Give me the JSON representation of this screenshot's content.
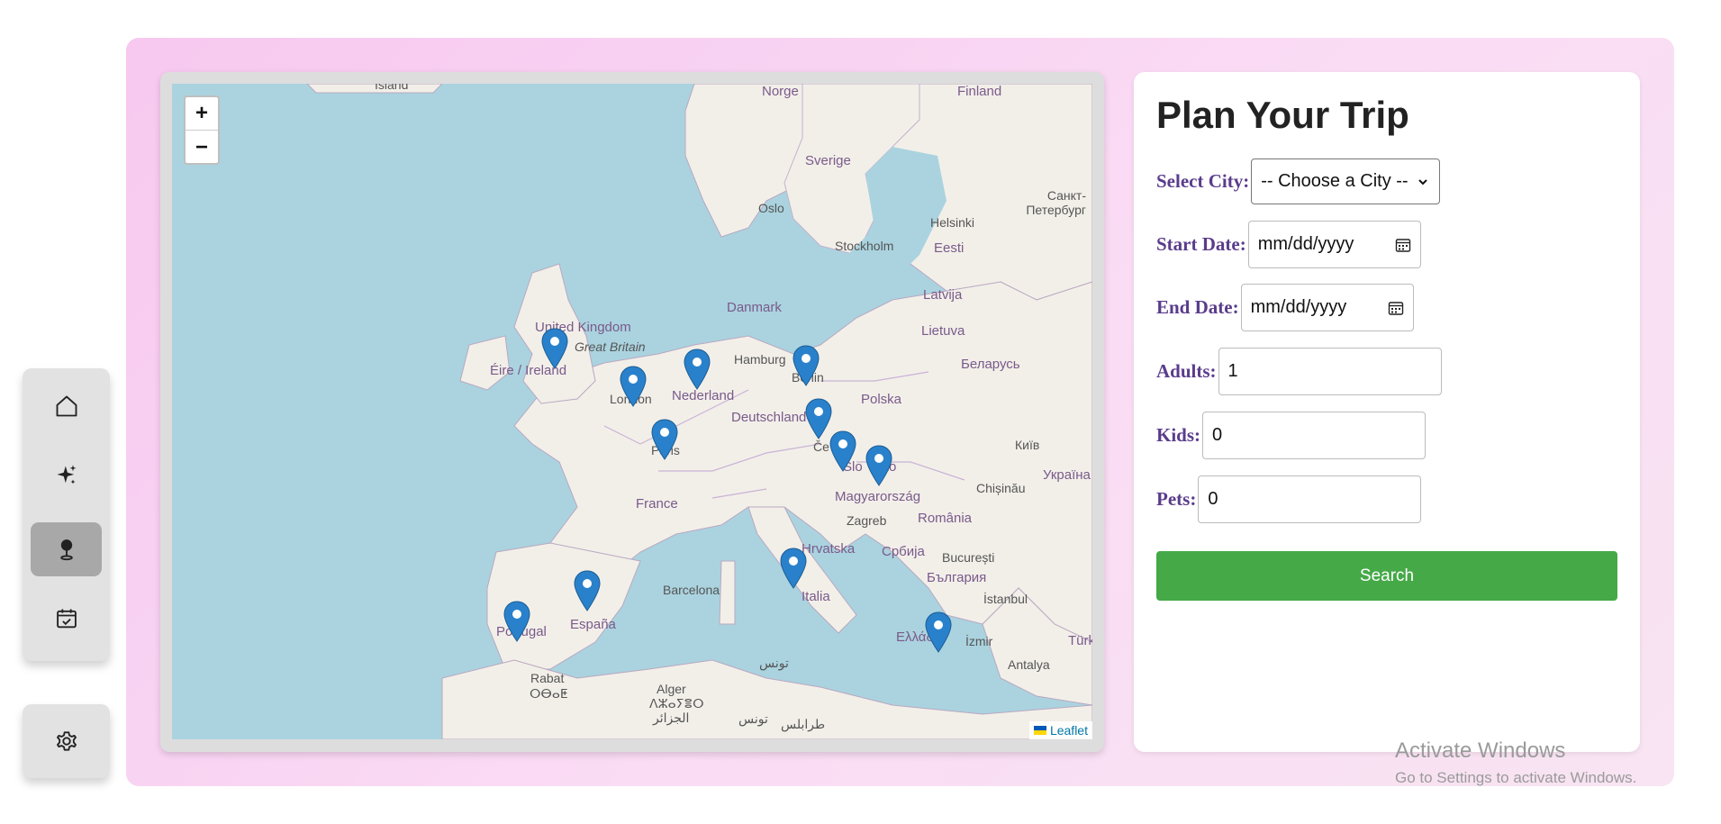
{
  "sidebar": {
    "items": [
      {
        "icon": "home-icon",
        "active": false
      },
      {
        "icon": "sparkles-icon",
        "active": false
      },
      {
        "icon": "map-pin-icon",
        "active": true
      },
      {
        "icon": "calendar-check-icon",
        "active": false
      }
    ],
    "settings_icon": "gear-icon"
  },
  "map": {
    "zoom_in": "+",
    "zoom_out": "−",
    "attribution": "Leaflet",
    "labels": {
      "island": "Ísland",
      "norge": "Norge",
      "finland": "Finland",
      "sverige": "Sverige",
      "oslo": "Oslo",
      "stockholm": "Stockholm",
      "helsinki": "Helsinki",
      "spb": "Санкт-Петербург",
      "eesti": "Eesti",
      "latvija": "Latvija",
      "danmark": "Danmark",
      "lietuva": "Lietuva",
      "belarus": "Беларусь",
      "uk": "United Kingdom",
      "gb": "Great Britain",
      "ireland": "Éire / Ireland",
      "hamburg": "Hamburg",
      "berlin": "Berlin",
      "nederland": "Nederland",
      "london": "London",
      "deutschland": "Deutschland",
      "polska": "Polska",
      "kyiv": "Київ",
      "paris": "Paris",
      "ce": "Če",
      "sl": "Slo",
      "sko": "sko",
      "france": "France",
      "chisinau": "Chișinău",
      "ukraina": "Україна",
      "magyar": "Magyarország",
      "zagreb": "Zagreb",
      "romania": "România",
      "hrvatska": "Hrvatska",
      "srbija": "Србија",
      "bucuresti": "București",
      "barcelona": "Barcelona",
      "italia": "Italia",
      "bulgaria": "България",
      "istanbul": "İstanbul",
      "espana": "España",
      "portugal": "Portugal",
      "ellada": "Ελλάδα",
      "izmir": "İzmir",
      "turk": "Türk",
      "antalya": "Antalya",
      "tunis": "تونس",
      "rabat": "Rabat",
      "amazigh": "ⵔⴱⴰⵟ",
      "alger": "Alger",
      "alger_ar": "ⴷⵣⴰⵢⴻⵔ",
      "alger_ar2": "الجزائر",
      "tunis2": "تونس",
      "tripoli": "طرابلس"
    }
  },
  "form": {
    "title": "Plan Your Trip",
    "city_label": "Select City:",
    "city_value": "-- Choose a City --",
    "start_label": "Start Date:",
    "start_placeholder": "mm/dd/yyyy",
    "end_label": "End Date:",
    "end_placeholder": "mm/dd/yyyy",
    "adults_label": "Adults:",
    "adults_value": "1",
    "kids_label": "Kids:",
    "kids_value": "0",
    "pets_label": "Pets:",
    "pets_value": "0",
    "search_label": "Search",
    "search_color": "#45a948"
  },
  "watermark": {
    "line1": "Activate Windows",
    "line2": "Go to Settings to activate Windows."
  }
}
